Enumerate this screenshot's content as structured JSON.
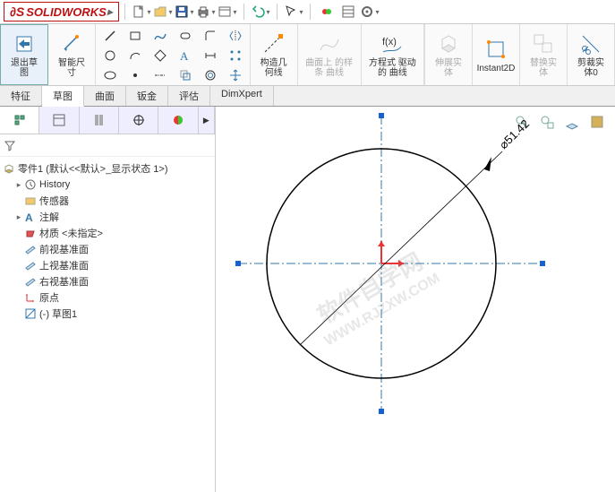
{
  "app": {
    "name": "SOLIDWORKS"
  },
  "topbar": {
    "icons": [
      "new",
      "open",
      "save",
      "print",
      "props",
      "undo",
      "redo",
      "select",
      "rebuild",
      "options",
      "settings"
    ]
  },
  "ribbon": {
    "exit": {
      "label": "退出草\n图"
    },
    "smart_dim": {
      "label": "智能尺\n寸"
    },
    "construct": {
      "label": "构造几\n何线"
    },
    "spline": {
      "label": "曲面上\n的样条\n曲线"
    },
    "equation": {
      "label": "方程式\n驱动的\n曲线"
    },
    "extrude": {
      "label": "伸展实\n体"
    },
    "instant": {
      "label": "Instant2D"
    },
    "replace": {
      "label": "替换实\n体"
    },
    "trim": {
      "label": "剪裁实\n体0"
    }
  },
  "tabs": [
    "特征",
    "草图",
    "曲面",
    "钣金",
    "评估",
    "DimXpert"
  ],
  "active_tab": "草图",
  "tree": {
    "root": "零件1  (默认<<默认>_显示状态 1>)",
    "items": [
      {
        "icon": "history",
        "label": "History"
      },
      {
        "icon": "sensor",
        "label": "传感器"
      },
      {
        "icon": "annot",
        "label": "注解"
      },
      {
        "icon": "mat",
        "label": "材质 <未指定>"
      },
      {
        "icon": "plane",
        "label": "前视基准面"
      },
      {
        "icon": "plane",
        "label": "上视基准面"
      },
      {
        "icon": "plane",
        "label": "右视基准面"
      },
      {
        "icon": "origin",
        "label": "原点"
      },
      {
        "icon": "sketch",
        "label": "(-) 草图1"
      }
    ]
  },
  "dimension": {
    "label": "51.42",
    "symbol": "⌀"
  },
  "watermark": {
    "line1": "软件自学网",
    "line2": "WWW.RJZXW.COM"
  },
  "chart_data": {
    "type": "diagram",
    "shape": "circle",
    "diameter": 51.42,
    "origin": "center",
    "axes": [
      "horizontal",
      "vertical"
    ]
  }
}
